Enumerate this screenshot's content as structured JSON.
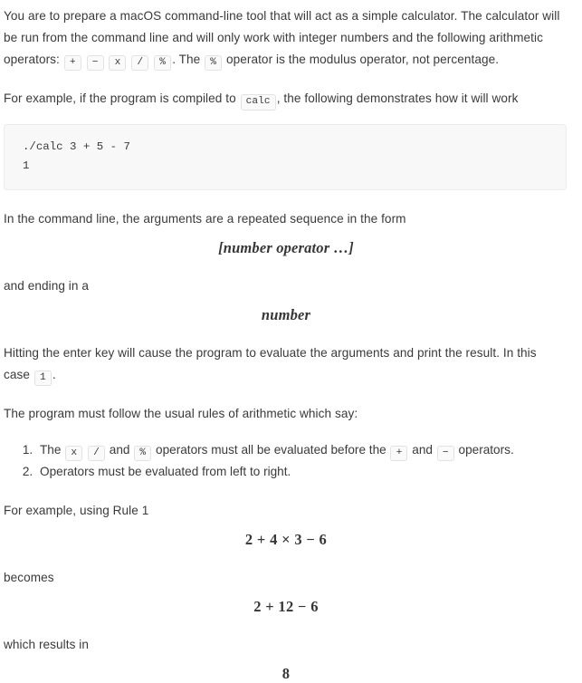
{
  "document": {
    "intro": {
      "before_ops": "You are to prepare a macOS command-line tool that will act as a simple calculator. The calculator will be run from the command line and will only work with integer numbers and  the following arithmetic operators:",
      "operators": [
        "+",
        "−",
        "x",
        "/",
        "%"
      ],
      "after_ops_prefix": ". The",
      "modulus_op": "%",
      "after_ops_suffix": "operator is the modulus operator, not percentage."
    },
    "example_intro": {
      "before_code": "For example, if the program is compiled to",
      "code": "calc",
      "after_code": ", the following demonstrates how it will work"
    },
    "code_block": "./calc 3 + 5 - 7\n1",
    "form_intro": "In the command line, the arguments are a repeated sequence in the form",
    "form_math": "[number operator …]",
    "ending_intro": "and ending in a",
    "ending_math": "number",
    "enter_key": {
      "before_code": "Hitting the enter key will cause the program to evaluate the arguments and print the result. In this case",
      "code": "1",
      "after_code": "."
    },
    "rules_intro": "The program must follow the usual rules of arithmetic which say:",
    "rules": {
      "rule1": {
        "part1": "The",
        "op_a": "x",
        "op_b": "/",
        "part2": "and",
        "op_c": "%",
        "part3": "operators must all be evaluated before the",
        "op_d": "+",
        "part4": "and",
        "op_e": "−",
        "part5": "operators."
      },
      "rule2": "Operators must be evaluated from left to right."
    },
    "rule1_example_intro": "For example, using Rule 1",
    "expression_1": "2 + 4 × 3 − 6",
    "becomes_label": "becomes",
    "expression_2": "2 + 12 − 6",
    "results_label": "which results in",
    "expression_3": "8"
  }
}
